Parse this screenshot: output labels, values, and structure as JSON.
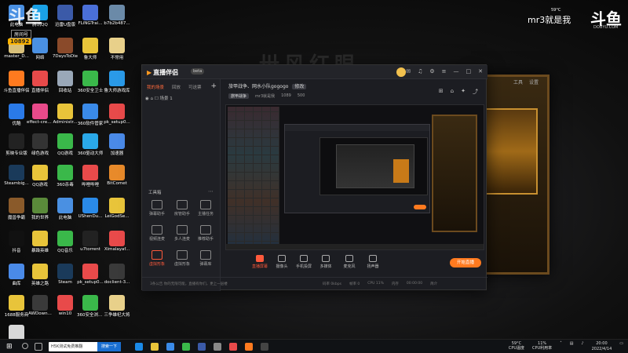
{
  "watermark": {
    "brand": "斗鱼",
    "room_label": "房间号",
    "room_id": "10892",
    "right_text": "mr3就是我",
    "right_brand": "斗鱼",
    "right_sub": "DOUYU.COM",
    "weather": "59°C"
  },
  "wallpaper": {
    "title": "卅风红眼",
    "menu": [
      "工具",
      "设置"
    ]
  },
  "desktop_icons": [
    {
      "label": "此电脑",
      "color": "#4a90e2"
    },
    {
      "label": "腾讯QQ",
      "color": "#1aa1e6"
    },
    {
      "label": "迅雷U盘版",
      "color": "#3b5aa8"
    },
    {
      "label": "FLiNGTrai...",
      "color": "#4a6fd8"
    },
    {
      "label": "b7b2b487...",
      "color": "#6b8aa8"
    },
    {
      "label": "master_D...",
      "color": "#d8c07a"
    },
    {
      "label": "网络",
      "color": "#4a90e2"
    },
    {
      "label": "7DaysToDie",
      "color": "#8a4a2a"
    },
    {
      "label": "鲁大师",
      "color": "#e8c43a"
    },
    {
      "label": "不常用",
      "color": "#e8d08a"
    },
    {
      "label": "斗鱼直播伴侣",
      "color": "#ff7a1f"
    },
    {
      "label": "直播伴侣",
      "color": "#e84a4a"
    },
    {
      "label": "回收站",
      "color": "#9aa8b8"
    },
    {
      "label": "360安全卫士",
      "color": "#3ab84a"
    },
    {
      "label": "鲁大师游戏库",
      "color": "#2a9ae8"
    },
    {
      "label": "优酷",
      "color": "#2a7ae8"
    },
    {
      "label": "effect-crea...",
      "color": "#e84a8a"
    },
    {
      "label": "Administr...",
      "color": "#e8c43a"
    },
    {
      "label": "360软件管家",
      "color": "#3a8ae8"
    },
    {
      "label": "pk_setup0...",
      "color": "#e84a4a"
    },
    {
      "label": "剪映专业版",
      "color": "#222222"
    },
    {
      "label": "绿色游戏",
      "color": "#333333"
    },
    {
      "label": "QQ游戏",
      "color": "#3ab84a"
    },
    {
      "label": "360驱动大师",
      "color": "#2aa8e8"
    },
    {
      "label": "加速器",
      "color": "#4a8ae8"
    },
    {
      "label": "Steambig...",
      "color": "#1a3a5a"
    },
    {
      "label": "QQ游戏",
      "color": "#e8c43a"
    },
    {
      "label": "360杀毒",
      "color": "#3ab84a"
    },
    {
      "label": "哔哩哔哩",
      "color": "#e84a4a"
    },
    {
      "label": "BitComet",
      "color": "#e88a2a"
    },
    {
      "label": "魔兽争霸",
      "color": "#8a5a2a"
    },
    {
      "label": "我的世界",
      "color": "#5a8a3a"
    },
    {
      "label": "此电脑",
      "color": "#4a90e2"
    },
    {
      "label": "UShenDu...",
      "color": "#2a8ae8"
    },
    {
      "label": "LeiGodSe...",
      "color": "#e8c43a"
    },
    {
      "label": "抖音",
      "color": "#111111"
    },
    {
      "label": "暴躁英雄",
      "color": "#e8c43a"
    },
    {
      "label": "QQ音乐",
      "color": "#3ab84a"
    },
    {
      "label": "u7torrent",
      "color": "#222222"
    },
    {
      "label": "Ximalayaf...",
      "color": "#e84a4a"
    },
    {
      "label": "曲库",
      "color": "#4a8ae8"
    },
    {
      "label": "英雄之路",
      "color": "#e8c43a"
    },
    {
      "label": "Steam",
      "color": "#1a3a5a"
    },
    {
      "label": "pk_setup0...",
      "color": "#e84a4a"
    },
    {
      "label": "doclient-3...",
      "color": "#3a3a3a"
    },
    {
      "label": "1688服务商",
      "color": "#e8c43a"
    },
    {
      "label": "AWDown...",
      "color": "#3a3a3a"
    },
    {
      "label": "win10",
      "color": "#e84a4a"
    },
    {
      "label": "360安全浏览器",
      "color": "#3ab84a"
    },
    {
      "label": "三争雄杞大将",
      "color": "#e8d08a"
    },
    {
      "label": "a5650c04...",
      "color": "#d8d8d8"
    }
  ],
  "app": {
    "logo": "直播伴侣",
    "version": "beta",
    "left_tabs": [
      "我的场景",
      "回放",
      "可送票"
    ],
    "scene_name": "场景 1",
    "tools_head": "工具箱",
    "tools": [
      {
        "label": "弹幕助手",
        "active": false
      },
      {
        "label": "房管助手",
        "active": false
      },
      {
        "label": "主播任务",
        "active": false
      },
      {
        "label": "视频连麦",
        "active": false
      },
      {
        "label": "多人连麦",
        "active": false
      },
      {
        "label": "推荐助手",
        "active": false
      },
      {
        "label": "虚拟形象",
        "active": true
      },
      {
        "label": "虚拟形象",
        "active": false
      },
      {
        "label": "弹幕库",
        "active": false
      }
    ],
    "stream_title": "旅甲战争、网水小队gogogo",
    "stream_tag": "修改",
    "stream_game": "旅甲战争",
    "stream_room": "mr3就是我",
    "stream_fans": "1089",
    "stream_hot": "500",
    "bottom_items": [
      {
        "label": "直播屏幕",
        "live": true
      },
      {
        "label": "摄像头",
        "live": false
      },
      {
        "label": "手机投屏",
        "live": false
      },
      {
        "label": "多媒体",
        "live": false
      },
      {
        "label": "麦克风",
        "live": false
      },
      {
        "label": "扬声器",
        "live": false
      }
    ],
    "go_live": "开始直播",
    "status_notice": "3条公告  你的无限可能，直播有你们，更上一层楼",
    "status_stats": [
      "码率 0kbps",
      "帧率 0",
      "CPU 11%",
      "内存",
      "00:00:00",
      "简介"
    ]
  },
  "taskbar": {
    "search_text": "H5K测试免费推翻",
    "search_button": "搜索一下",
    "tray_temp": "59°C",
    "tray_temp_label": "CPU温度",
    "tray_cpu": "11%",
    "tray_cpu_label": "CPU利用率",
    "time": "20:00",
    "date": "2022/4/14"
  }
}
